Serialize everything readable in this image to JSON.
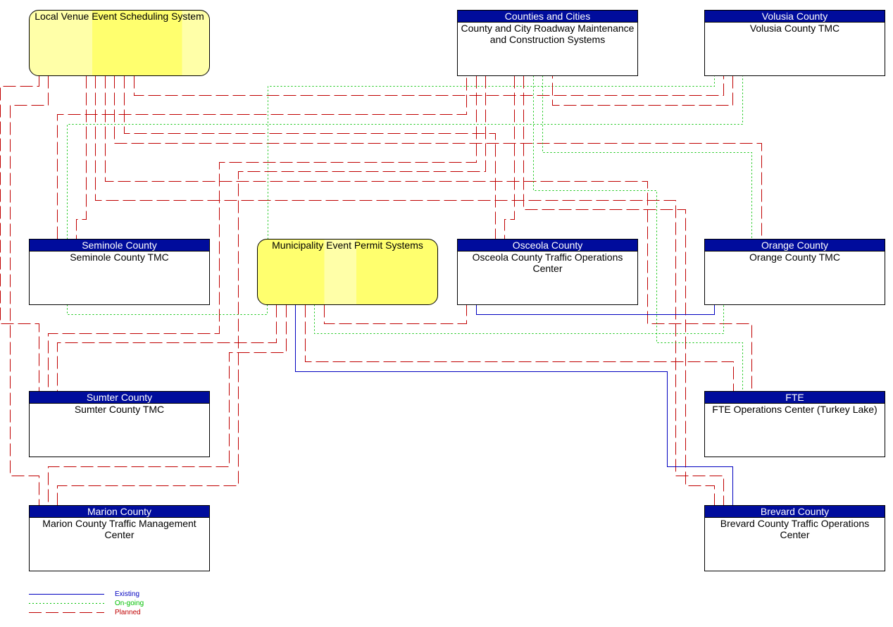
{
  "colors": {
    "existing": "#0000c0",
    "ongoing": "#00c000",
    "planned": "#c00000",
    "header": "#000c9c",
    "yellow": "#ffff6e"
  },
  "nodes": {
    "lvess": {
      "title": "Local Venue Event Scheduling System"
    },
    "cc": {
      "header": "Counties and Cities",
      "title": "County and City Roadway Maintenance and Construction Systems"
    },
    "volusia": {
      "header": "Volusia County",
      "title": "Volusia County TMC"
    },
    "seminole": {
      "header": "Seminole County",
      "title": "Seminole County TMC"
    },
    "muni": {
      "title": "Municipality Event Permit Systems"
    },
    "osceola": {
      "header": "Osceola County",
      "title": "Osceola County Traffic Operations Center"
    },
    "orange": {
      "header": "Orange County",
      "title": "Orange County TMC"
    },
    "sumter": {
      "header": "Sumter County",
      "title": "Sumter County TMC"
    },
    "fte": {
      "header": "FTE",
      "title": "FTE Operations Center (Turkey Lake)"
    },
    "marion": {
      "header": "Marion County",
      "title": "Marion County Traffic Management Center"
    },
    "brevard": {
      "header": "Brevard County",
      "title": "Brevard County Traffic Operations Center"
    }
  },
  "connections": [
    {
      "from": "lvess",
      "to": "sumter",
      "status": "planned"
    },
    {
      "from": "lvess",
      "to": "marion",
      "status": "planned"
    },
    {
      "from": "lvess",
      "to": "seminole",
      "status": "planned"
    },
    {
      "from": "lvess",
      "to": "brevard",
      "status": "planned"
    },
    {
      "from": "lvess",
      "to": "fte",
      "status": "planned"
    },
    {
      "from": "lvess",
      "to": "orange",
      "status": "planned"
    },
    {
      "from": "lvess",
      "to": "osceola",
      "status": "planned"
    },
    {
      "from": "lvess",
      "to": "volusia",
      "status": "planned"
    },
    {
      "from": "seminole",
      "to": "cc",
      "status": "planned"
    },
    {
      "from": "seminole",
      "to": "volusia",
      "status": "ongoing"
    },
    {
      "from": "muni",
      "to": "volusia",
      "status": "ongoing"
    },
    {
      "from": "cc",
      "to": "sumter",
      "status": "planned"
    },
    {
      "from": "cc",
      "to": "marion",
      "status": "planned"
    },
    {
      "from": "cc",
      "to": "osceola",
      "status": "planned"
    },
    {
      "from": "cc",
      "to": "volusia",
      "status": "planned"
    },
    {
      "from": "cc",
      "to": "fte",
      "status": "ongoing"
    },
    {
      "from": "cc",
      "to": "orange",
      "status": "ongoing"
    },
    {
      "from": "cc",
      "to": "brevard",
      "status": "planned"
    },
    {
      "from": "seminole",
      "to": "muni",
      "status": "ongoing"
    },
    {
      "from": "muni",
      "to": "sumter",
      "status": "planned"
    },
    {
      "from": "muni",
      "to": "marion",
      "status": "planned"
    },
    {
      "from": "muni",
      "to": "brevard",
      "status": "existing"
    },
    {
      "from": "muni",
      "to": "fte",
      "status": "planned"
    },
    {
      "from": "muni",
      "to": "osceola",
      "status": "planned"
    },
    {
      "from": "muni",
      "to": "orange",
      "status": "ongoing"
    },
    {
      "from": "osceola",
      "to": "orange",
      "status": "existing"
    }
  ],
  "legend": [
    {
      "status": "existing",
      "label": "Existing"
    },
    {
      "status": "ongoing",
      "label": "On-going"
    },
    {
      "status": "planned",
      "label": "Planned"
    }
  ]
}
